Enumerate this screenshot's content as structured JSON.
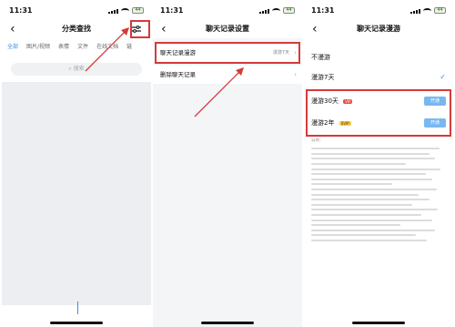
{
  "screens": [
    {
      "time": "11:31",
      "title": "分类查找",
      "tabs": [
        "全部",
        "图片/视频",
        "表情",
        "文件",
        "在线文档",
        "链"
      ],
      "search_placeholder": "搜索"
    },
    {
      "time": "11:31",
      "title": "聊天记录设置",
      "rows": [
        {
          "label": "聊天记录漫游",
          "value": "漫游7天"
        },
        {
          "label": "删除聊天记录"
        }
      ]
    },
    {
      "time": "11:31",
      "title": "聊天记录漫游",
      "options": [
        {
          "label": "不漫游"
        },
        {
          "label": "漫游7天"
        },
        {
          "label": "漫游30天",
          "badge": "VIP",
          "button": "开通"
        },
        {
          "label": "漫游2年",
          "badge": "SVIP",
          "button": "开通"
        }
      ],
      "description_heading": "说明："
    }
  ],
  "status_battery": "44",
  "colors": {
    "accent": "#3a8ee6",
    "highlight": "#d43a3a",
    "vip": "#e94c3d",
    "svip": "#f2c84b"
  }
}
